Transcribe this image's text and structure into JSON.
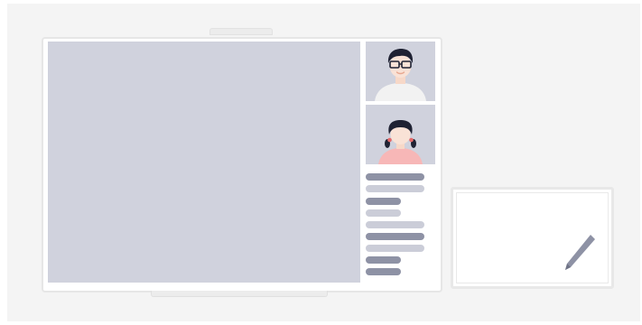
{
  "scene": {
    "description_free": true,
    "colors": {
      "background": "#f4f4f4",
      "screen_fill": "#d0d2dd",
      "line_dark": "#8e92a5",
      "line_light": "#cbcdd8",
      "frame": "#e6e6e6"
    }
  },
  "monitor": {
    "participants": [
      {
        "icon": "man-with-glasses-avatar-icon"
      },
      {
        "icon": "woman-avatar-icon"
      }
    ],
    "chat_lines": [
      {
        "tone": "dark",
        "width_fraction": 1.0
      },
      {
        "tone": "light",
        "width_fraction": 1.0
      },
      {
        "tone": "dark",
        "width_fraction": 0.6
      },
      {
        "tone": "light",
        "width_fraction": 0.6
      },
      {
        "tone": "light",
        "width_fraction": 1.0
      },
      {
        "tone": "dark",
        "width_fraction": 1.0
      },
      {
        "tone": "light",
        "width_fraction": 1.0
      },
      {
        "tone": "dark",
        "width_fraction": 0.6
      },
      {
        "tone": "dark",
        "width_fraction": 0.6
      }
    ]
  },
  "tablet": {
    "icon": "stylus-pen-icon"
  }
}
